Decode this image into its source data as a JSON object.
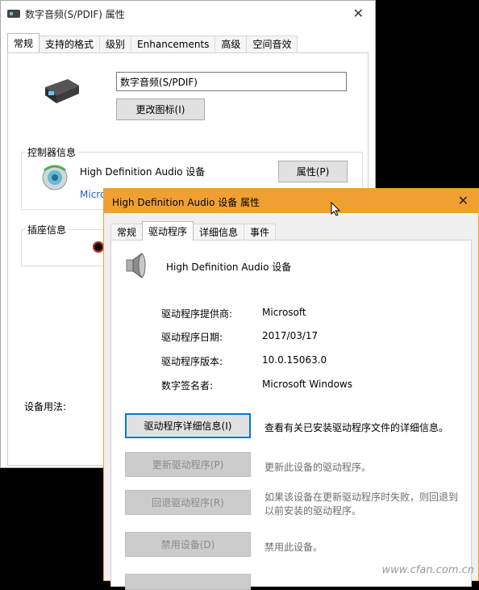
{
  "back_window": {
    "title": "数字音频(S/PDIF) 属性",
    "close": "✕",
    "tabs": [
      "常规",
      "支持的格式",
      "级别",
      "Enhancements",
      "高级",
      "空间音效"
    ],
    "device_name": "数字音频(S/PDIF)",
    "change_icon_button": "更改图标(I)",
    "controller_group_label": "控制器信息",
    "controller_name": "High Definition Audio 设备",
    "controller_vendor_partial": "Micro",
    "properties_button": "属性(P)",
    "jack_group_label": "插座信息",
    "device_usage_label": "设备用法:"
  },
  "front_window": {
    "title": "High Definition Audio 设备 属性",
    "close": "✕",
    "tabs": [
      "常规",
      "驱动程序",
      "详细信息",
      "事件"
    ],
    "device_name": "High Definition Audio 设备",
    "info": [
      {
        "label": "驱动程序提供商:",
        "value": "Microsoft"
      },
      {
        "label": "驱动程序日期:",
        "value": "2017/03/17"
      },
      {
        "label": "驱动程序版本:",
        "value": "10.0.15063.0"
      },
      {
        "label": "数字签名者:",
        "value": "Microsoft Windows"
      }
    ],
    "actions": [
      {
        "button": "驱动程序详细信息(I)",
        "desc": "查看有关已安装驱动程序文件的详细信息。"
      },
      {
        "button": "更新驱动程序(P)",
        "desc": "更新此设备的驱动程序。"
      },
      {
        "button": "回退驱动程序(R)",
        "desc": "如果该设备在更新驱动程序时失败，则回退到以前安装的驱动程序。"
      },
      {
        "button": "禁用设备(D)",
        "desc": "禁用此设备。"
      }
    ]
  },
  "watermark": "www.cfan.com.cn",
  "colors": {
    "accent_title": "#f0a030",
    "focus_border": "#0078d7"
  }
}
